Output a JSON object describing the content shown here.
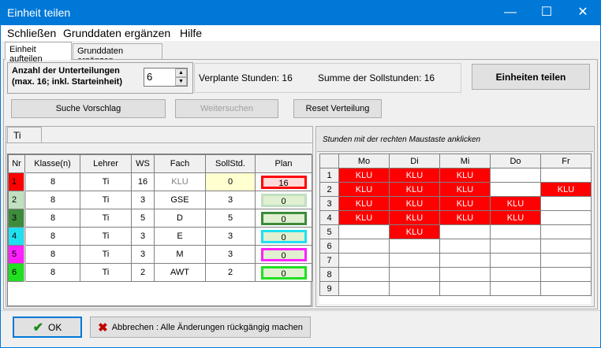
{
  "window": {
    "title": "Einheit teilen",
    "minimize": "—",
    "maximize": "☐",
    "close": "✕"
  },
  "menu": [
    "Schließen",
    "Grunddaten ergänzen",
    "Hilfe"
  ],
  "tabs": [
    "Einheit aufteilen",
    "Grunddaten ergänzen"
  ],
  "split": {
    "label_line1": "Anzahl der Unterteilungen",
    "label_line2": "(max. 16; inkl. Starteinheit)",
    "value": "6",
    "planned_label": "Verplante Stunden: 16",
    "target_label": "Summe der Sollstunden: 16",
    "split_button": "Einheiten teilen"
  },
  "actions": {
    "suggest": "Suche Vorschlag",
    "continue": "Weitersuchen",
    "reset": "Reset Verteilung"
  },
  "teacher_tab": "Ti",
  "units_table": {
    "headers": [
      "Nr",
      "Klasse(n)",
      "Lehrer",
      "WS",
      "Fach",
      "SollStd.",
      "Plan"
    ],
    "rows": [
      {
        "nr": "1",
        "klasse": "8",
        "lehrer": "Ti",
        "ws": "16",
        "fach": "KLU",
        "soll": "0",
        "plan": "16",
        "color": "#ff0000",
        "soll_bg": "#ffffd0",
        "plan_bg": "#ffd8d8",
        "plan_border": "#ff0000",
        "fach_color": "#808080"
      },
      {
        "nr": "2",
        "klasse": "8",
        "lehrer": "Ti",
        "ws": "3",
        "fach": "GSE",
        "soll": "3",
        "plan": "0",
        "color": "#c0e0c0",
        "soll_bg": "#ffffff",
        "plan_bg": "#e0f0d0",
        "plan_border": "#c0e0c0",
        "fach_color": "#000000"
      },
      {
        "nr": "3",
        "klasse": "8",
        "lehrer": "Ti",
        "ws": "5",
        "fach": "D",
        "soll": "5",
        "plan": "0",
        "color": "#3c8c3c",
        "soll_bg": "#ffffff",
        "plan_bg": "#e0f0d0",
        "plan_border": "#3c8c3c",
        "fach_color": "#000000"
      },
      {
        "nr": "4",
        "klasse": "8",
        "lehrer": "Ti",
        "ws": "3",
        "fach": "E",
        "soll": "3",
        "plan": "0",
        "color": "#20e0f0",
        "soll_bg": "#ffffff",
        "plan_bg": "#e0f0d0",
        "plan_border": "#20e0f0",
        "fach_color": "#000000"
      },
      {
        "nr": "5",
        "klasse": "8",
        "lehrer": "Ti",
        "ws": "3",
        "fach": "M",
        "soll": "3",
        "plan": "0",
        "color": "#ff20ff",
        "soll_bg": "#ffffff",
        "plan_bg": "#e0f0d0",
        "plan_border": "#ff20ff",
        "fach_color": "#000000"
      },
      {
        "nr": "6",
        "klasse": "8",
        "lehrer": "Ti",
        "ws": "2",
        "fach": "AWT",
        "soll": "2",
        "plan": "0",
        "color": "#20e020",
        "soll_bg": "#ffffff",
        "plan_bg": "#e0f0d0",
        "plan_border": "#20e020",
        "fach_color": "#000000"
      }
    ]
  },
  "schedule": {
    "hint": "Stunden mit der rechten Maustaste anklicken",
    "days": [
      "Mo",
      "Di",
      "Mi",
      "Do",
      "Fr"
    ],
    "periods": [
      "1",
      "2",
      "3",
      "4",
      "5",
      "6",
      "7",
      "8",
      "9"
    ],
    "cells": [
      [
        "KLU",
        "KLU",
        "KLU",
        "",
        ""
      ],
      [
        "KLU",
        "KLU",
        "KLU",
        "",
        "KLU"
      ],
      [
        "KLU",
        "KLU",
        "KLU",
        "KLU",
        ""
      ],
      [
        "KLU",
        "KLU",
        "KLU",
        "KLU",
        ""
      ],
      [
        "",
        "KLU",
        "",
        "",
        ""
      ],
      [
        "",
        "",
        "",
        "",
        ""
      ],
      [
        "",
        "",
        "",
        "",
        ""
      ],
      [
        "",
        "",
        "",
        "",
        ""
      ],
      [
        "",
        "",
        "",
        "",
        ""
      ]
    ]
  },
  "footer": {
    "ok": "OK",
    "cancel": "Abbrechen : Alle Änderungen rückgängig machen"
  }
}
